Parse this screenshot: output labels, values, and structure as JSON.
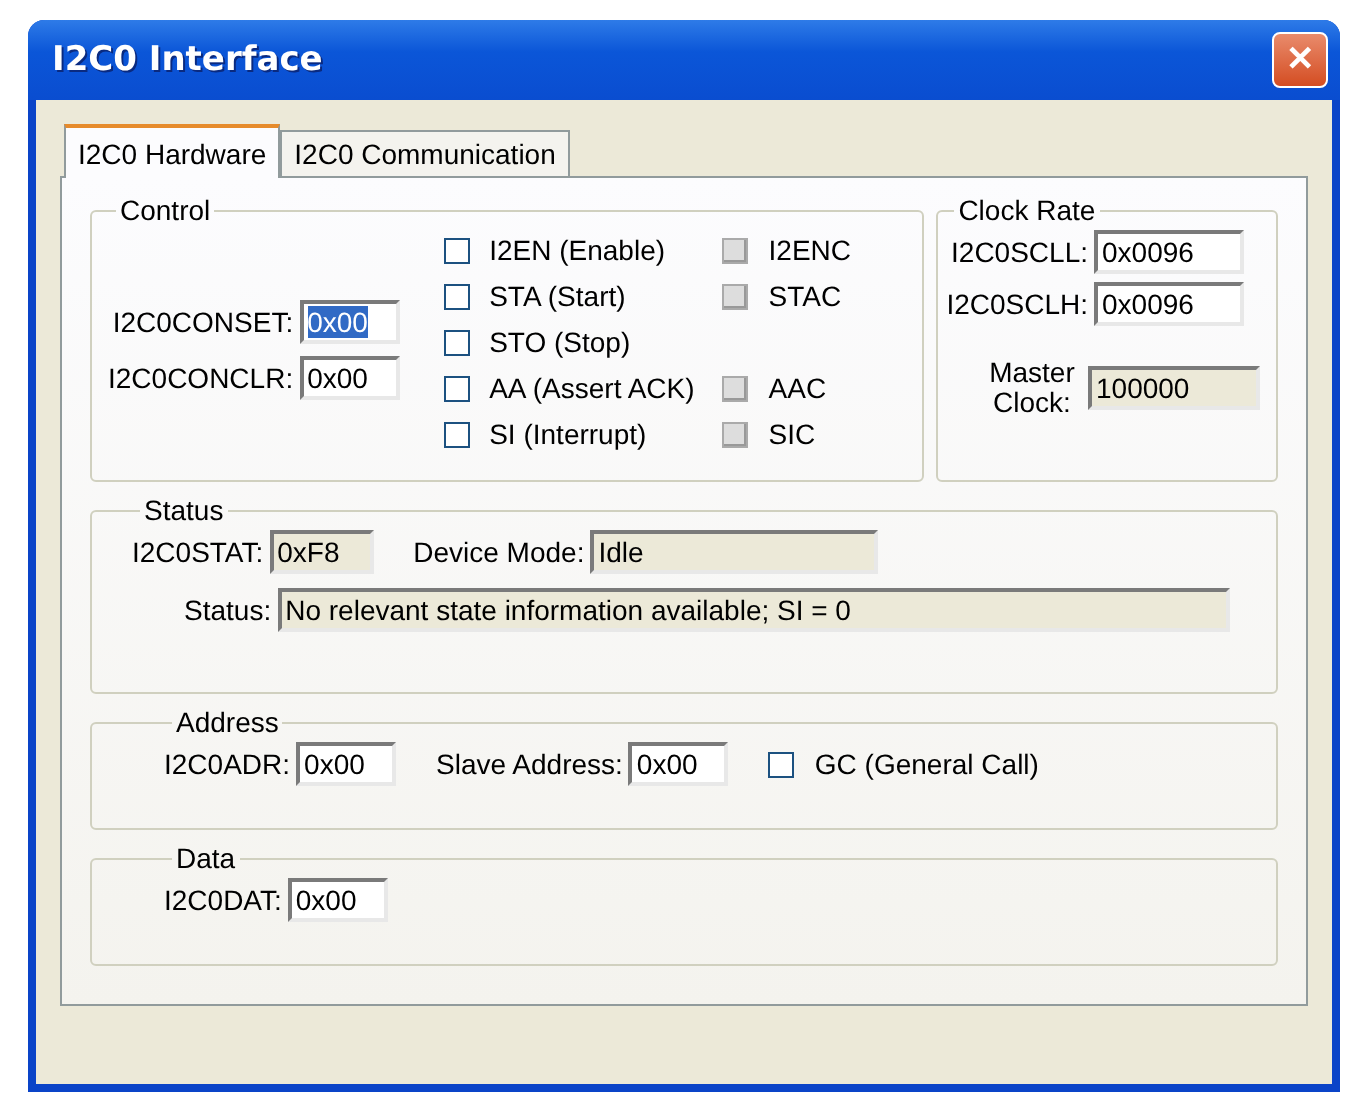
{
  "window": {
    "title": "I2C0 Interface",
    "close": "✕"
  },
  "tabs": [
    {
      "label": "I2C0 Hardware",
      "selected": true
    },
    {
      "label": "I2C0 Communication",
      "selected": false
    }
  ],
  "control": {
    "title": "Control",
    "fields": [
      {
        "label": "I2C0CONSET:",
        "value": "0x00",
        "selected": true,
        "disabled": false
      },
      {
        "label": "I2C0CONCLR:",
        "value": "0x00",
        "selected": false,
        "disabled": false
      }
    ],
    "bits": [
      {
        "label": "I2EN (Enable)",
        "checked": false,
        "disabled": false,
        "clear": {
          "label": "I2ENC",
          "checked": false,
          "disabled": true
        }
      },
      {
        "label": "STA (Start)",
        "checked": false,
        "disabled": false,
        "clear": {
          "label": "STAC",
          "checked": false,
          "disabled": true
        }
      },
      {
        "label": "STO (Stop)",
        "checked": false,
        "disabled": false
      },
      {
        "label": "AA (Assert ACK)",
        "checked": false,
        "disabled": false,
        "clear": {
          "label": "AAC",
          "checked": false,
          "disabled": true
        }
      },
      {
        "label": "SI (Interrupt)",
        "checked": false,
        "disabled": false,
        "clear": {
          "label": "SIC",
          "checked": false,
          "disabled": true
        }
      }
    ]
  },
  "clock_rate": {
    "title": "Clock Rate",
    "fields": [
      {
        "label": "I2C0SCLL:",
        "value": "0x0096",
        "selected": false,
        "disabled": false
      },
      {
        "label": "I2C0SCLH:",
        "value": "0x0096",
        "selected": false,
        "disabled": false
      },
      {
        "label": "Master Clock:",
        "value": "100000",
        "selected": false,
        "disabled": true
      }
    ]
  },
  "status": {
    "title": "Status",
    "fields": [
      {
        "label": "I2C0STAT:",
        "value": "0xF8",
        "selected": false,
        "disabled": true
      },
      {
        "label": "Device Mode:",
        "value": "Idle",
        "selected": false,
        "disabled": true
      },
      {
        "label": "Status:",
        "value": "No relevant state information available; SI = 0",
        "selected": false,
        "disabled": true
      }
    ]
  },
  "address": {
    "title": "Address",
    "fields": [
      {
        "label": "I2C0ADR:",
        "value": "0x00",
        "selected": false,
        "disabled": false
      },
      {
        "label": "Slave Address:",
        "value": "0x00",
        "selected": false,
        "disabled": false
      }
    ],
    "checkbox": {
      "label": "GC (General Call)",
      "checked": false,
      "disabled": false
    }
  },
  "data": {
    "title": "Data",
    "fields": [
      {
        "label": "I2C0DAT:",
        "value": "0x00",
        "selected": false,
        "disabled": false
      }
    ]
  }
}
